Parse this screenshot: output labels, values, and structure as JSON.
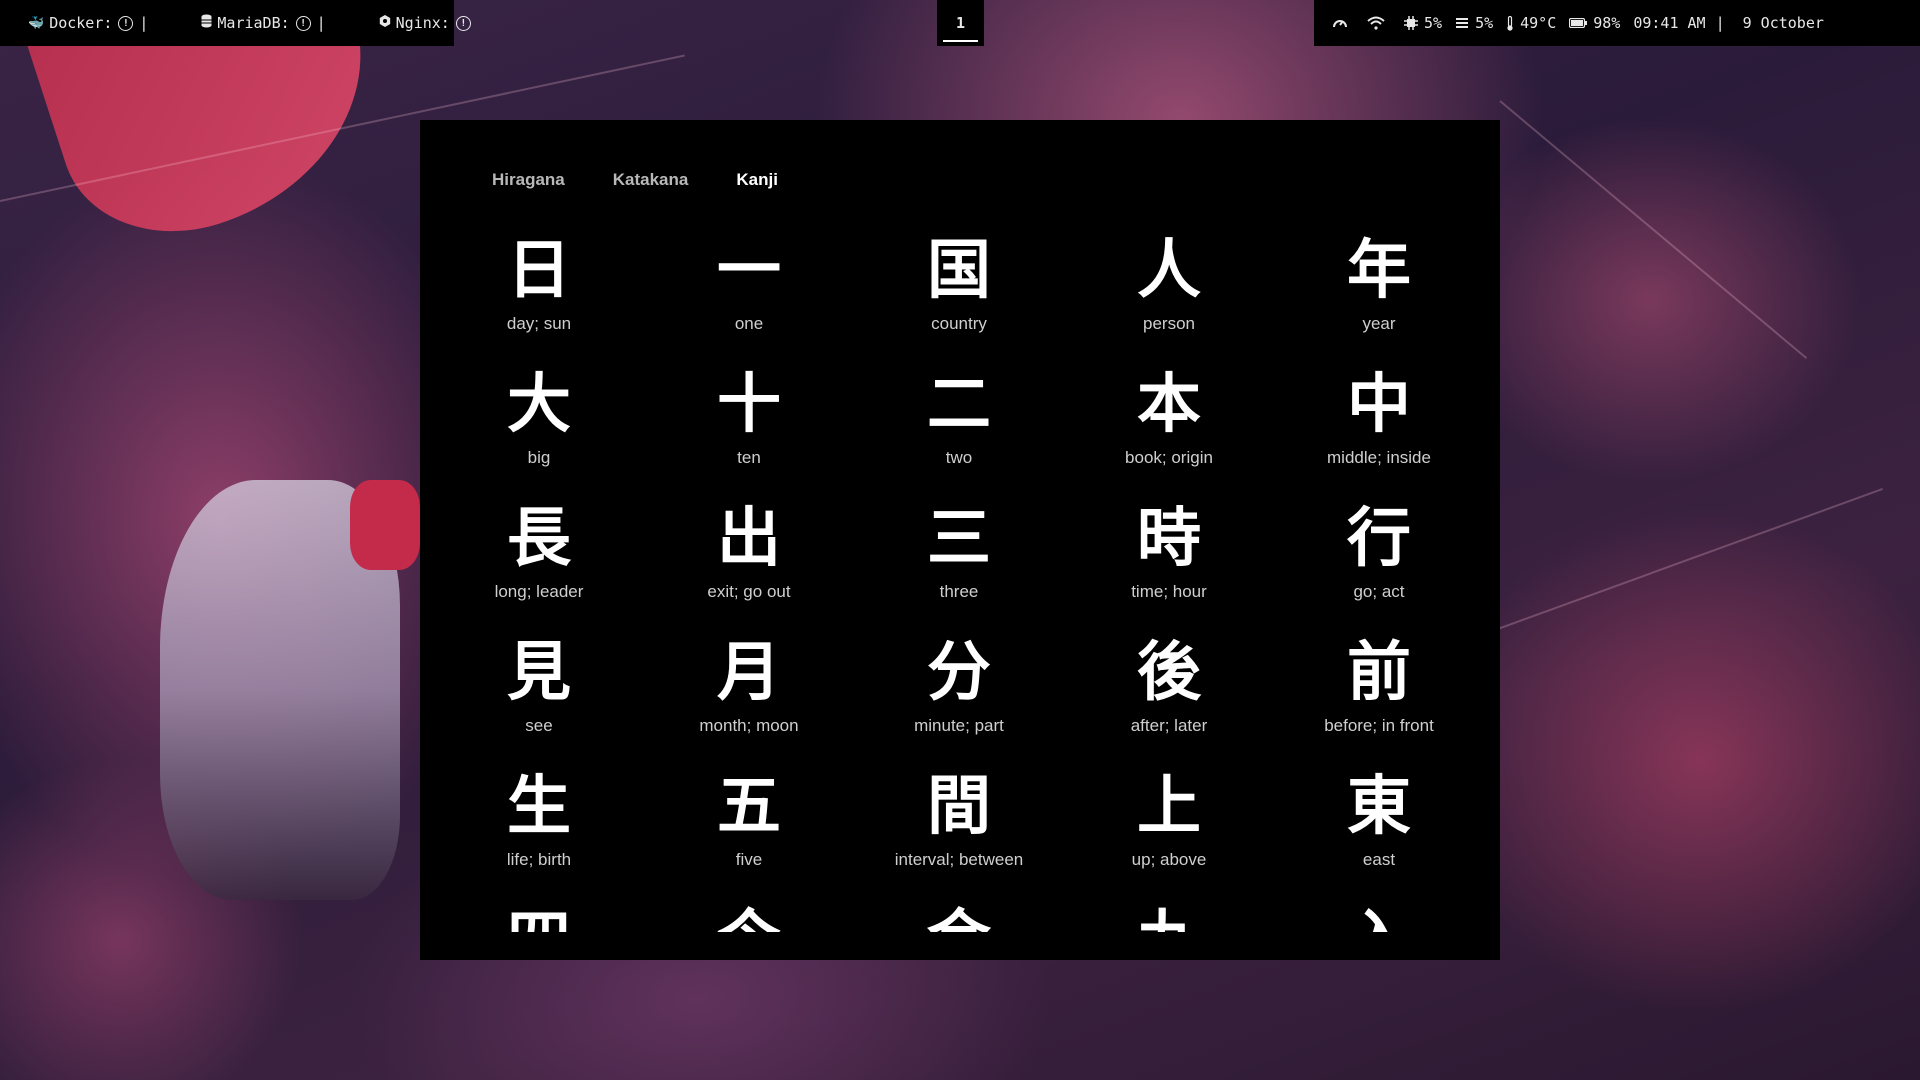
{
  "topbar": {
    "left": {
      "docker_label": "Docker:",
      "mariadb_label": "MariaDB:",
      "nginx_label": "Nginx:",
      "separator": "|"
    },
    "workspace": "1",
    "right": {
      "wifi_icon": "wifi-icon",
      "cpu_value": "5%",
      "memory_value": "5%",
      "temperature": "49°C",
      "battery": "98%",
      "time": "09:41 AM",
      "separator": "|",
      "date": "9 October"
    }
  },
  "tabs": [
    {
      "label": "Hiragana",
      "active": false
    },
    {
      "label": "Katakana",
      "active": false
    },
    {
      "label": "Kanji",
      "active": true
    }
  ],
  "kanji": [
    {
      "char": "日",
      "meaning": "day; sun"
    },
    {
      "char": "一",
      "meaning": "one"
    },
    {
      "char": "国",
      "meaning": "country"
    },
    {
      "char": "人",
      "meaning": "person"
    },
    {
      "char": "年",
      "meaning": "year"
    },
    {
      "char": "大",
      "meaning": "big"
    },
    {
      "char": "十",
      "meaning": "ten"
    },
    {
      "char": "二",
      "meaning": "two"
    },
    {
      "char": "本",
      "meaning": "book; origin"
    },
    {
      "char": "中",
      "meaning": "middle; inside"
    },
    {
      "char": "長",
      "meaning": "long; leader"
    },
    {
      "char": "出",
      "meaning": "exit; go out"
    },
    {
      "char": "三",
      "meaning": "three"
    },
    {
      "char": "時",
      "meaning": "time; hour"
    },
    {
      "char": "行",
      "meaning": "go; act"
    },
    {
      "char": "見",
      "meaning": "see"
    },
    {
      "char": "月",
      "meaning": "month; moon"
    },
    {
      "char": "分",
      "meaning": "minute; part"
    },
    {
      "char": "後",
      "meaning": "after; later"
    },
    {
      "char": "前",
      "meaning": "before; in front"
    },
    {
      "char": "生",
      "meaning": "life; birth"
    },
    {
      "char": "五",
      "meaning": "five"
    },
    {
      "char": "間",
      "meaning": "interval; between"
    },
    {
      "char": "上",
      "meaning": "up; above"
    },
    {
      "char": "東",
      "meaning": "east"
    },
    {
      "char": "四",
      "meaning": ""
    },
    {
      "char": "今",
      "meaning": ""
    },
    {
      "char": "金",
      "meaning": ""
    },
    {
      "char": "九",
      "meaning": ""
    },
    {
      "char": "入",
      "meaning": ""
    }
  ],
  "colors": {
    "bar_bg": "#000000",
    "window_bg": "#000000",
    "text_primary": "#ffffff",
    "text_muted": "#b8b8b8"
  }
}
